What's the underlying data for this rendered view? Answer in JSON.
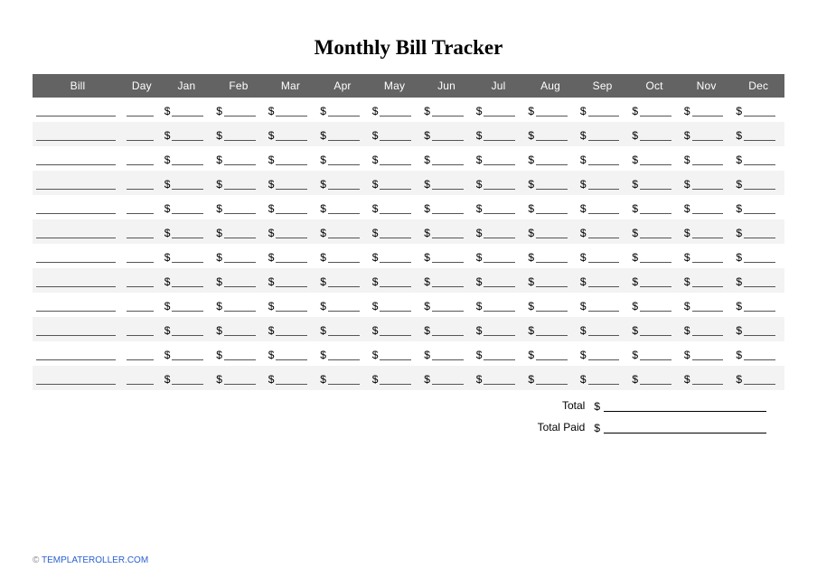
{
  "title": "Monthly Bill Tracker",
  "columns": [
    "Bill",
    "Day",
    "Jan",
    "Feb",
    "Mar",
    "Apr",
    "May",
    "Jun",
    "Jul",
    "Aug",
    "Sep",
    "Oct",
    "Nov",
    "Dec"
  ],
  "currency_prefix": "$",
  "row_count": 12,
  "totals": {
    "total_label": "Total",
    "total_paid_label": "Total Paid"
  },
  "footer": {
    "copyright": "©",
    "site": "TEMPLATEROLLER.COM"
  }
}
